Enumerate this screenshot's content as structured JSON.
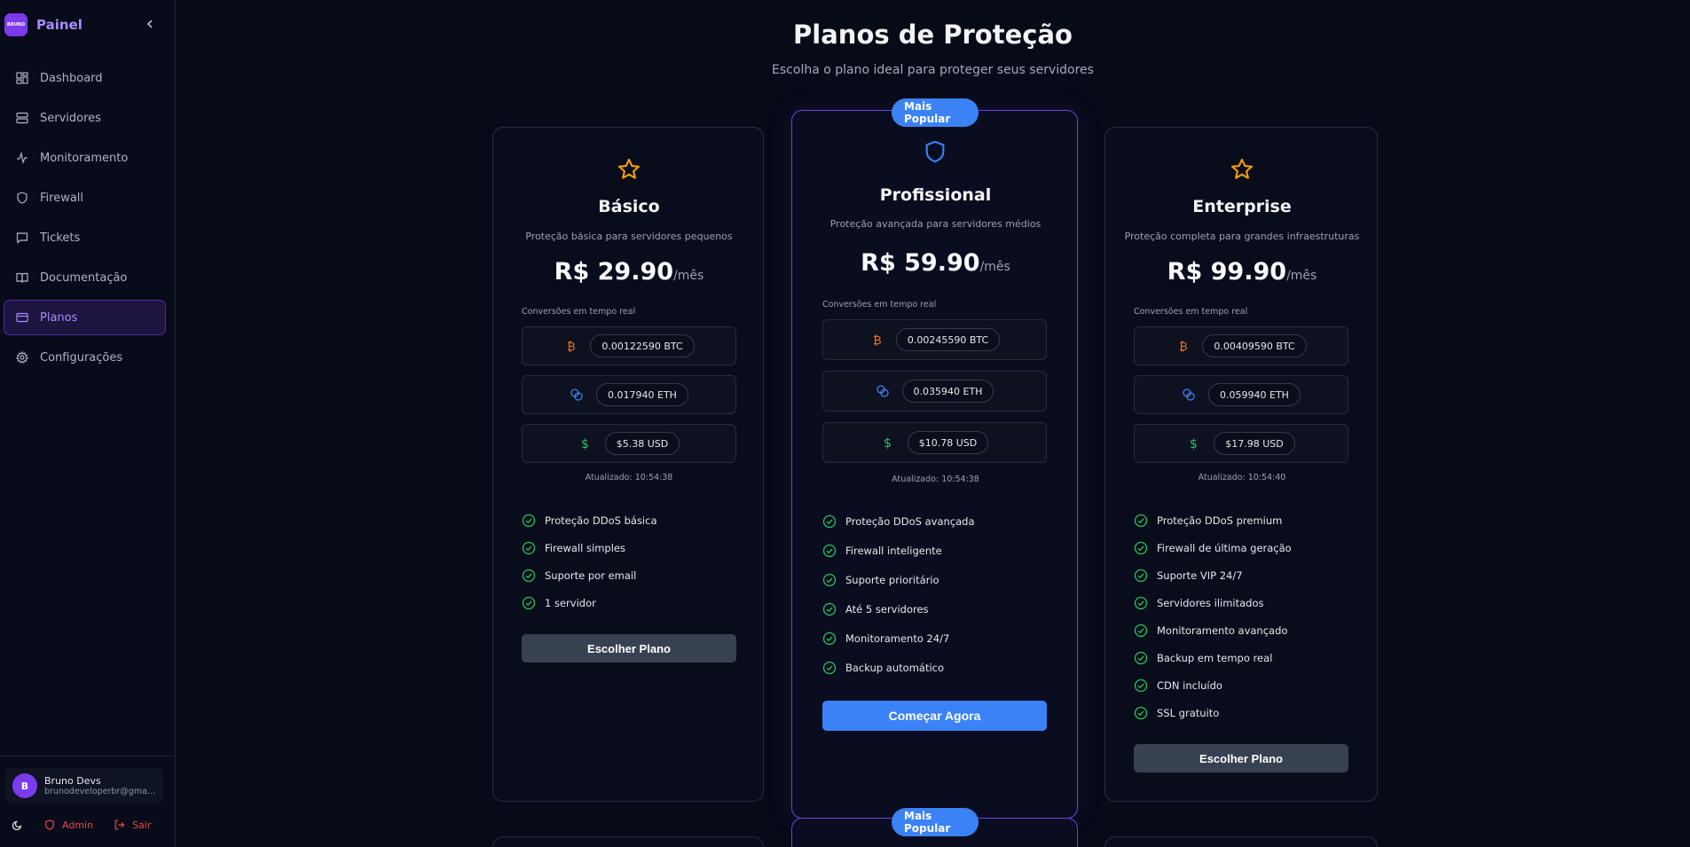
{
  "sidebar": {
    "brand": "Painel",
    "brand_logo_text": "BRUNO",
    "items": [
      {
        "label": "Dashboard",
        "icon": "grid-icon"
      },
      {
        "label": "Servidores",
        "icon": "server-icon"
      },
      {
        "label": "Monitoramento",
        "icon": "activity-icon"
      },
      {
        "label": "Firewall",
        "icon": "shield-icon"
      },
      {
        "label": "Tickets",
        "icon": "message-icon"
      },
      {
        "label": "Documentação",
        "icon": "book-icon"
      },
      {
        "label": "Planos",
        "icon": "card-icon",
        "active": true
      },
      {
        "label": "Configurações",
        "icon": "gear-icon"
      }
    ],
    "user": {
      "initial": "B",
      "name": "Bruno Devs",
      "email": "brunodeveloperbr@gmail.com"
    },
    "admin_label": "Admin",
    "logout_label": "Sair"
  },
  "main": {
    "title": "Planos de Proteção",
    "subtitle": "Escolha o plano ideal para proteger seus servidores",
    "conversion_label": "Conversões em tempo real",
    "plans": [
      {
        "name": "Básico",
        "desc": "Proteção básica para servidores pequenos",
        "price": "R$ 29.90",
        "period": "/mês",
        "btc": "0.00122590 BTC",
        "eth": "0.017940 ETH",
        "usd": "$5.38 USD",
        "updated": "Atualizado: 10:54:38",
        "features": [
          "Proteção DDoS básica",
          "Firewall simples",
          "Suporte por email",
          "1 servidor"
        ],
        "button": "Escolher Plano"
      },
      {
        "name": "Profissional",
        "badge": "Mais Popular",
        "desc": "Proteção avançada para servidores médios",
        "price": "R$ 59.90",
        "period": "/mês",
        "btc": "0.00245590 BTC",
        "eth": "0.035940 ETH",
        "usd": "$10.78 USD",
        "updated": "Atualizado: 10:54:38",
        "features": [
          "Proteção DDoS avançada",
          "Firewall inteligente",
          "Suporte prioritário",
          "Até 5 servidores",
          "Monitoramento 24/7",
          "Backup automático"
        ],
        "button": "Começar Agora"
      },
      {
        "name": "Enterprise",
        "desc": "Proteção completa para grandes infraestruturas",
        "price": "R$ 99.90",
        "period": "/mês",
        "btc": "0.00409590 BTC",
        "eth": "0.059940 ETH",
        "usd": "$17.98 USD",
        "updated": "Atualizado: 10:54:40",
        "features": [
          "Proteção DDoS premium",
          "Firewall de última geração",
          "Suporte VIP 24/7",
          "Servidores ilimitados",
          "Monitoramento avançado",
          "Backup em tempo real",
          "CDN incluído",
          "SSL gratuito"
        ],
        "button": "Escolher Plano"
      }
    ],
    "second_row_badge": "Mais Popular"
  },
  "colors": {
    "accent": "#7c3aed",
    "primary_button": "#3b82f6",
    "check": "#22c55e",
    "star": "#f59e0b",
    "btc": "#f97316",
    "eth": "#3b82f6",
    "usd": "#22c55e",
    "danger": "#ef4444"
  }
}
